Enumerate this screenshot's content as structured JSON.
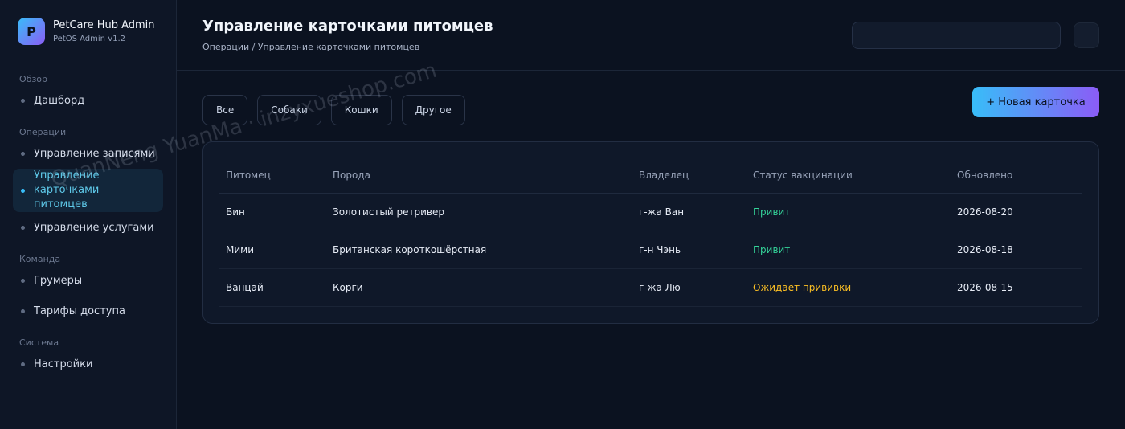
{
  "brand": {
    "logo_letter": "P",
    "title": "PetCare Hub Admin",
    "subtitle": "PetOS Admin v1.2"
  },
  "sidebar": {
    "sections": [
      {
        "label": "Обзор",
        "items": [
          {
            "label": "Дашборд"
          }
        ]
      },
      {
        "label": "Операции",
        "items": [
          {
            "label": "Управление записями"
          },
          {
            "label": "Управление карточками питомцев",
            "active": true
          },
          {
            "label": "Управление услугами"
          }
        ]
      },
      {
        "label": "Команда",
        "items": [
          {
            "label": "Грумеры"
          },
          {
            "label": "Тарифы доступа"
          }
        ]
      },
      {
        "label": "Система",
        "items": [
          {
            "label": "Настройки"
          }
        ]
      }
    ]
  },
  "header": {
    "title": "Управление карточками питомцев",
    "breadcrumb": "Операции / Управление карточками питомцев",
    "search_value": ""
  },
  "filters": [
    "Все",
    "Собаки",
    "Кошки",
    "Другое"
  ],
  "new_button_label": "+ Новая карточка",
  "table": {
    "columns": [
      "Питомец",
      "Порода",
      "Владелец",
      "Статус вакцинации",
      "Обновлено"
    ],
    "rows": [
      {
        "pet": "Бин",
        "breed": "Золотистый ретривер",
        "owner": "г-жа Ван",
        "status": "Привит",
        "status_type": "ok",
        "updated": "2026-08-20"
      },
      {
        "pet": "Мими",
        "breed": "Британская короткошёрстная",
        "owner": "г-н Чэнь",
        "status": "Привит",
        "status_type": "ok",
        "updated": "2026-08-18"
      },
      {
        "pet": "Ванцай",
        "breed": "Корги",
        "owner": "г-жа Лю",
        "status": "Ожидает прививки",
        "status_type": "wait",
        "updated": "2026-08-15"
      }
    ]
  },
  "watermark": "QuanNeng YuanMa · inzyxueshop.com",
  "colors": {
    "accent_from": "#38bdf8",
    "accent_to": "#8b5cf6",
    "status_ok": "#34d399",
    "status_wait": "#fbbf24"
  }
}
